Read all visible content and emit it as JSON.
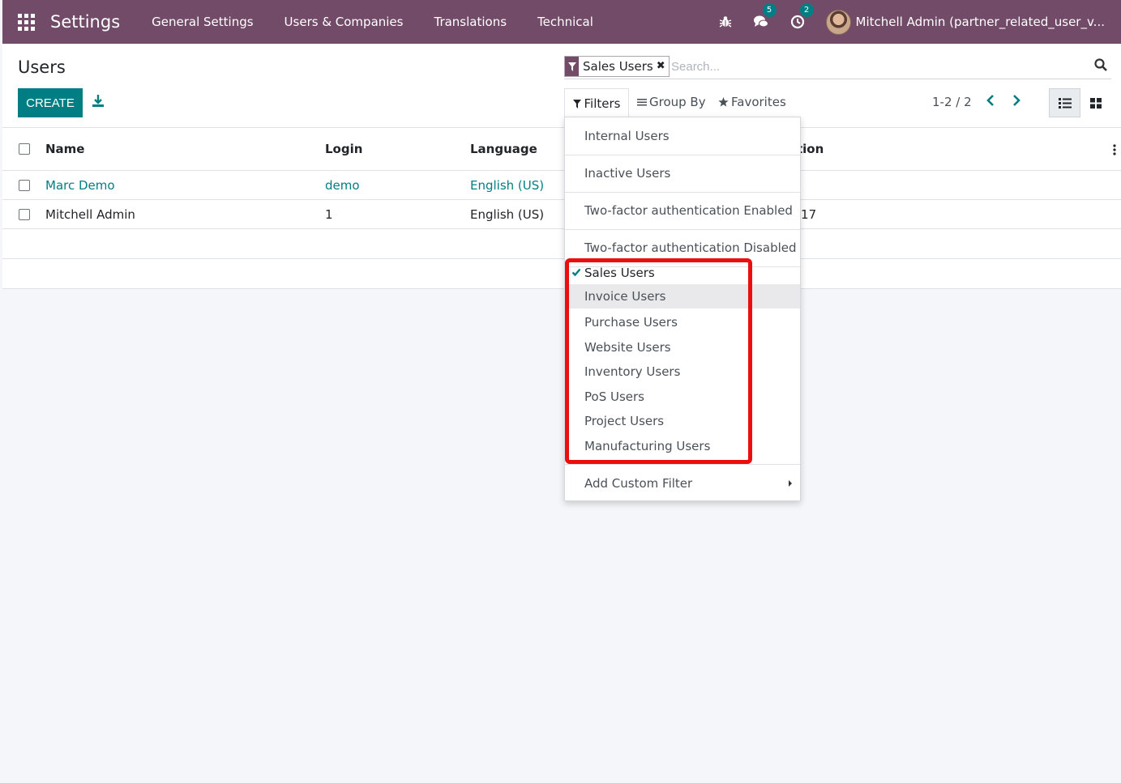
{
  "navbar": {
    "app_title": "Settings",
    "menu": [
      "General Settings",
      "Users & Companies",
      "Translations",
      "Technical"
    ],
    "messages_count": "5",
    "activities_count": "2",
    "user_name": "Mitchell Admin (partner_related_user_v..."
  },
  "control_panel": {
    "title": "Users",
    "create_label": "CREATE",
    "search": {
      "facet": "Sales Users",
      "facet_remove": "✖",
      "placeholder": "Search..."
    },
    "filters_label": "Filters",
    "groupby_label": "Group By",
    "favorites_label": "Favorites",
    "pager": "1-2 / 2"
  },
  "table": {
    "columns": [
      "Name",
      "Login",
      "Language",
      "tion"
    ],
    "rows": [
      {
        "name": "Marc Demo",
        "login": "demo",
        "language": "English (US)",
        "last": ""
      },
      {
        "name": "Mitchell Admin",
        "login": "1",
        "language": "English (US)",
        "last": ":17"
      }
    ]
  },
  "filters_menu": {
    "group1": [
      "Internal Users"
    ],
    "group2": [
      "Inactive Users"
    ],
    "group3": [
      "Two-factor authentication Enabled"
    ],
    "group4": [
      "Two-factor authentication Disabled"
    ],
    "group5": [
      "Sales Users",
      "Invoice Users",
      "Purchase Users",
      "Website Users",
      "Inventory Users",
      "PoS Users",
      "Project Users",
      "Manufacturing Users"
    ],
    "custom": "Add Custom Filter"
  },
  "colors": {
    "brand": "#714b67",
    "accent": "#017e84",
    "highlight": "#ec0e0e"
  }
}
